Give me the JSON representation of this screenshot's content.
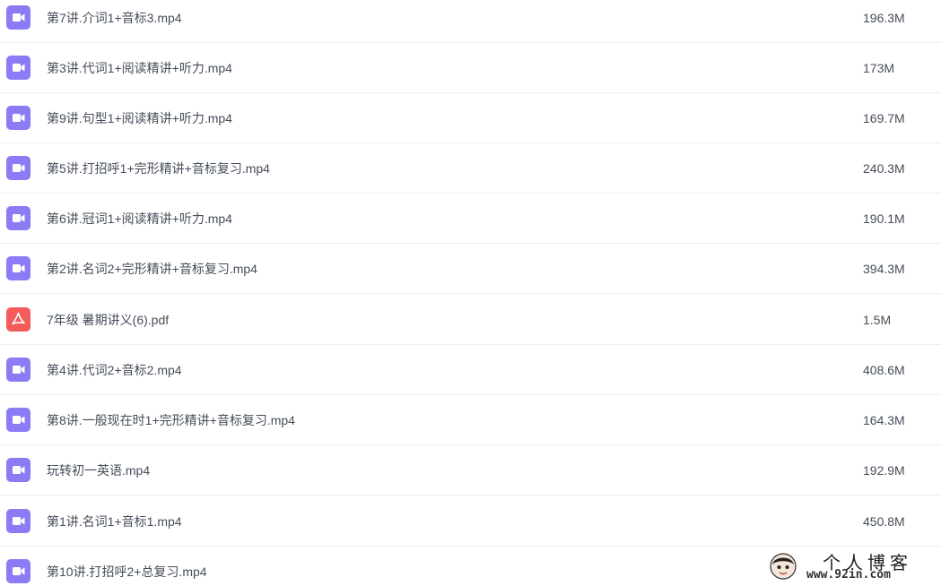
{
  "files": [
    {
      "name": "第7讲.介词1+音标3.mp4",
      "size": "196.3M",
      "type": "video",
      "icon": "video-file-icon"
    },
    {
      "name": "第3讲.代词1+阅读精讲+听力.mp4",
      "size": "173M",
      "type": "video",
      "icon": "video-file-icon"
    },
    {
      "name": "第9讲.句型1+阅读精讲+听力.mp4",
      "size": "169.7M",
      "type": "video",
      "icon": "video-file-icon"
    },
    {
      "name": "第5讲.打招呼1+完形精讲+音标复习.mp4",
      "size": "240.3M",
      "type": "video",
      "icon": "video-file-icon"
    },
    {
      "name": "第6讲.冠词1+阅读精讲+听力.mp4",
      "size": "190.1M",
      "type": "video",
      "icon": "video-file-icon"
    },
    {
      "name": "第2讲.名词2+完形精讲+音标复习.mp4",
      "size": "394.3M",
      "type": "video",
      "icon": "video-file-icon"
    },
    {
      "name": "7年级 暑期讲义(6).pdf",
      "size": "1.5M",
      "type": "pdf",
      "icon": "pdf-file-icon"
    },
    {
      "name": "第4讲.代词2+音标2.mp4",
      "size": "408.6M",
      "type": "video",
      "icon": "video-file-icon"
    },
    {
      "name": "第8讲.一般现在时1+完形精讲+音标复习.mp4",
      "size": "164.3M",
      "type": "video",
      "icon": "video-file-icon"
    },
    {
      "name": "玩转初一英语.mp4",
      "size": "192.9M",
      "type": "video",
      "icon": "video-file-icon"
    },
    {
      "name": "第1讲.名词1+音标1.mp4",
      "size": "450.8M",
      "type": "video",
      "icon": "video-file-icon"
    },
    {
      "name": "第10讲.打招呼2+总复习.mp4",
      "size": "",
      "type": "video",
      "icon": "video-file-icon"
    }
  ],
  "colors": {
    "video_icon": "#8b7cf6",
    "pdf_icon": "#f45b5b",
    "text": "#454d5a",
    "divider": "#eceef2"
  },
  "watermark": {
    "title": "个人博客",
    "url": "www.92in.com"
  }
}
